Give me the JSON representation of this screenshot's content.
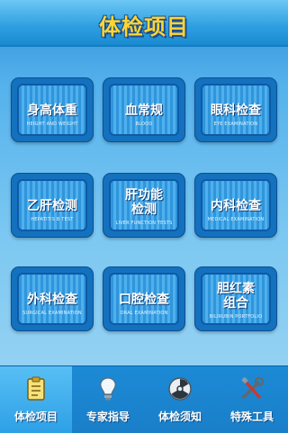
{
  "header": {
    "title": "体检项目"
  },
  "tiles": [
    {
      "label": "身高体重",
      "sub": "HEIGHT AND WEIGHT"
    },
    {
      "label": "血常规",
      "sub": "BLOOD"
    },
    {
      "label": "眼科检查",
      "sub": "EYE EXAMINATION"
    },
    {
      "label": "乙肝检测",
      "sub": "HEPATITIS B TEST"
    },
    {
      "label": "肝功能",
      "label2": "检测",
      "sub": "LIVER FUNCTION TESTS"
    },
    {
      "label": "内科检查",
      "sub": "MEDICAL EXAMINATION"
    },
    {
      "label": "外科检查",
      "sub": "SURGICAL EXAMINATION"
    },
    {
      "label": "口腔检查",
      "sub": "ORAL EXAMINATION"
    },
    {
      "label": "胆红素",
      "label2": "组合",
      "sub": "BILIRUBIN PORTFOLIO"
    }
  ],
  "tabs": [
    {
      "label": "体检项目",
      "icon": "clipboard-icon",
      "active": true
    },
    {
      "label": "专家指导",
      "icon": "lightbulb-icon",
      "active": false
    },
    {
      "label": "体检须知",
      "icon": "radiation-icon",
      "active": false
    },
    {
      "label": "特殊工具",
      "icon": "tools-icon",
      "active": false
    }
  ],
  "colors": {
    "title": "#ffd534",
    "tile": "#2f95dc",
    "tabbar": "#1c8ad6",
    "tab_active": "#58bff4"
  }
}
